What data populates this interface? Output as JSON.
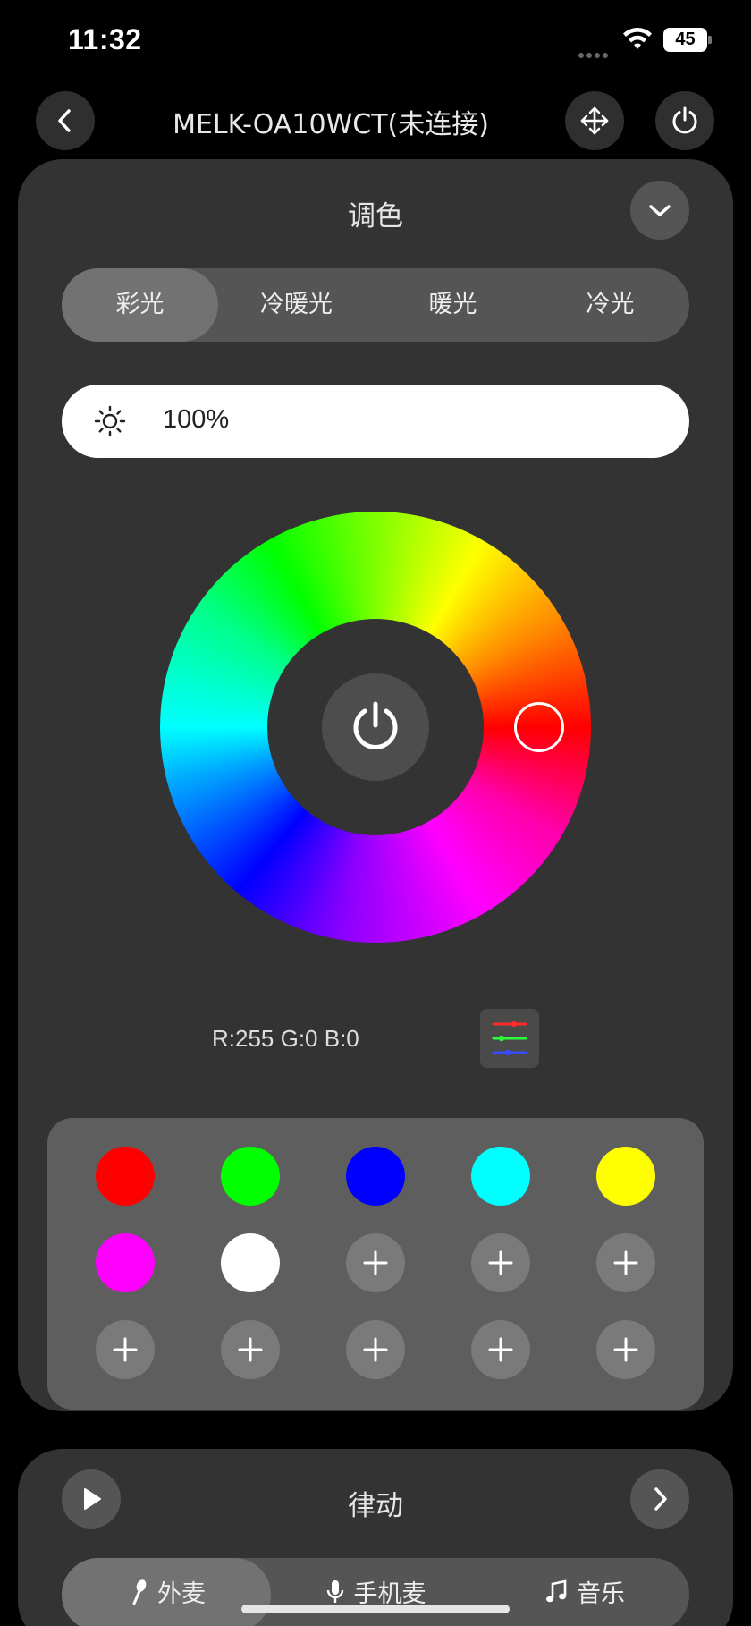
{
  "status_bar": {
    "time": "11:32",
    "battery": "45"
  },
  "header": {
    "title": "MELK-OA10WCT(未连接)"
  },
  "color_panel": {
    "title": "调色",
    "modes": [
      {
        "label": "彩光",
        "active": true
      },
      {
        "label": "冷暖光",
        "active": false
      },
      {
        "label": "暖光",
        "active": false
      },
      {
        "label": "冷光",
        "active": false
      }
    ],
    "brightness": "100%",
    "rgb_readout": "R:255 G:0 B:0",
    "presets": [
      {
        "type": "color",
        "color": "#ff0000"
      },
      {
        "type": "color",
        "color": "#00ff00"
      },
      {
        "type": "color",
        "color": "#0000ff"
      },
      {
        "type": "color",
        "color": "#00ffff"
      },
      {
        "type": "color",
        "color": "#ffff00"
      },
      {
        "type": "color",
        "color": "#ff00ff"
      },
      {
        "type": "color",
        "color": "#ffffff"
      },
      {
        "type": "add"
      },
      {
        "type": "add"
      },
      {
        "type": "add"
      },
      {
        "type": "add"
      },
      {
        "type": "add"
      },
      {
        "type": "add"
      },
      {
        "type": "add"
      },
      {
        "type": "add"
      }
    ]
  },
  "rhythm_panel": {
    "title": "律动",
    "sources": [
      {
        "label": "外麦",
        "icon": "microphone-icon",
        "active": true
      },
      {
        "label": "手机麦",
        "icon": "mic-icon",
        "active": false
      },
      {
        "label": "音乐",
        "icon": "music-note-icon",
        "active": false
      }
    ]
  }
}
